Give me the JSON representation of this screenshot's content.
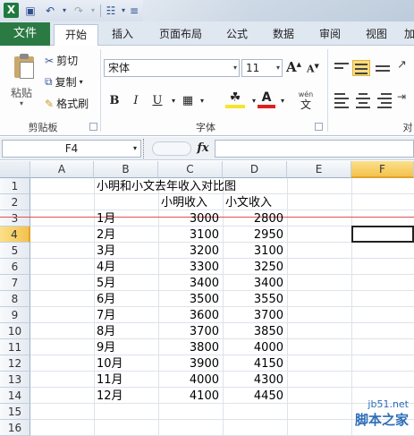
{
  "ribbon_tabs": [
    {
      "label": "文件"
    },
    {
      "label": "开始"
    },
    {
      "label": "插入"
    },
    {
      "label": "页面布局"
    },
    {
      "label": "公式"
    },
    {
      "label": "数据"
    },
    {
      "label": "审阅"
    },
    {
      "label": "视图"
    },
    {
      "label": "加"
    }
  ],
  "clipboard": {
    "paste_label": "粘贴",
    "cut_label": "剪切",
    "copy_label": "复制",
    "format_painter_label": "格式刷",
    "group_label": "剪贴板"
  },
  "font": {
    "font_name": "宋体",
    "font_size": "11",
    "grow_label": "A",
    "shrink_label": "A",
    "bold_label": "B",
    "italic_label": "I",
    "underline_label": "U",
    "fill_color": "#f5e52c",
    "font_color": "#e02020",
    "phonetic_label": "wén",
    "group_label": "字体"
  },
  "alignment": {
    "group_label": "对"
  },
  "formula_bar": {
    "name_box": "F4",
    "fx_label": "fx",
    "formula": ""
  },
  "columns": [
    "A",
    "B",
    "C",
    "D",
    "E",
    "F"
  ],
  "selected_column": "F",
  "rows": [
    "1",
    "2",
    "3",
    "4",
    "5",
    "6",
    "7",
    "8",
    "9",
    "10",
    "11",
    "12",
    "13",
    "14",
    "15",
    "16"
  ],
  "selected_row": "4",
  "sheet": {
    "title": "小明和小文去年收入对比图",
    "header_c": "小明收入",
    "header_d": "小文收入",
    "data": [
      {
        "month": "1月",
        "xiaoming": "3000",
        "xiaowen": "2800"
      },
      {
        "month": "2月",
        "xiaoming": "3100",
        "xiaowen": "2950"
      },
      {
        "month": "3月",
        "xiaoming": "3200",
        "xiaowen": "3100"
      },
      {
        "month": "4月",
        "xiaoming": "3300",
        "xiaowen": "3250"
      },
      {
        "month": "5月",
        "xiaoming": "3400",
        "xiaowen": "3400"
      },
      {
        "month": "6月",
        "xiaoming": "3500",
        "xiaowen": "3550"
      },
      {
        "month": "7月",
        "xiaoming": "3600",
        "xiaowen": "3700"
      },
      {
        "month": "8月",
        "xiaoming": "3700",
        "xiaowen": "3850"
      },
      {
        "month": "9月",
        "xiaoming": "3800",
        "xiaowen": "4000"
      },
      {
        "month": "10月",
        "xiaoming": "3900",
        "xiaowen": "4150"
      },
      {
        "month": "11月",
        "xiaoming": "4000",
        "xiaowen": "4300"
      },
      {
        "month": "12月",
        "xiaoming": "4100",
        "xiaowen": "4450"
      }
    ]
  },
  "watermark": {
    "site": "jb51.net",
    "name": "脚本之家"
  }
}
